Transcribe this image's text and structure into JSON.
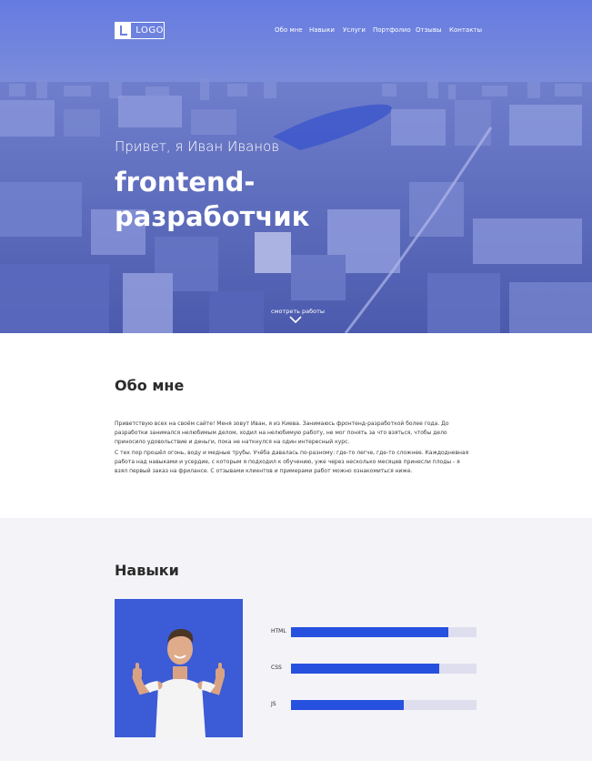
{
  "header": {
    "logo_text": "LOGO",
    "nav": [
      "Обо мне",
      "Навыки",
      "Услуги",
      "Портфолио",
      "Отзывы",
      "Контакты"
    ]
  },
  "hero": {
    "greeting": "Привет, я Иван Иванов",
    "headline": "frontend-разработчик",
    "see_works": "смотреть работы"
  },
  "about": {
    "title": "Обо мне",
    "paragraphs": [
      "Приветствую всех на своём сайте! Меня зовут Иван, я из Киева. Занимаюсь фронтенд-разработкой более года. До разработки занимался нелюбимым делом, ходил на нелюбимую работу, не мог понять за что взяться, чтобы дело приносило удовольствие и деньги, пока не наткнулся на один интересный курс.",
      "С тех пор прошёл огонь, воду и медные трубы. Учёба давалась по-разному: где-то легче, где-то сложнее.  Каждодневная работа над навыками и усердие, с которым я подходил к обучению, уже через несколько месяцев принесли плоды - я взял первый заказ на фрилансе. С отзывами клиентов и примерами работ можно ознакомиться ниже."
    ]
  },
  "skills": {
    "title": "Навыки",
    "items": [
      {
        "label": "HTML",
        "level": 0.85
      },
      {
        "label": "CSS",
        "level": 0.8
      },
      {
        "label": "JS",
        "level": 0.61
      }
    ]
  },
  "colors": {
    "accent": "#2650de",
    "bar_track": "#dedeee",
    "photo_bg": "#3c5bd6",
    "skills_bg": "#f4f4f8"
  }
}
